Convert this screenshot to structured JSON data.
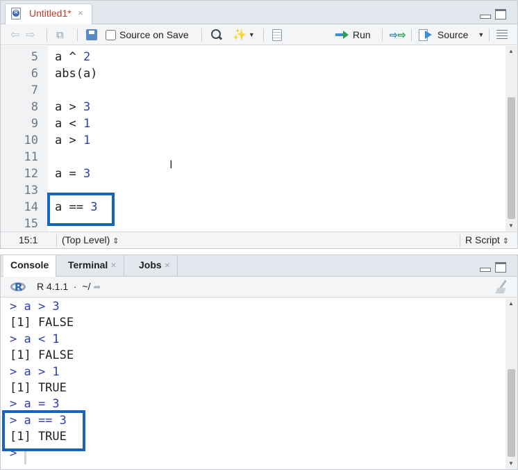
{
  "editor": {
    "tab": {
      "title": "Untitled1*",
      "close": "×",
      "icon": "r-file-icon"
    },
    "toolbar": {
      "source_on_save": "Source on Save",
      "run": "Run",
      "source": "Source",
      "icons": [
        "back-arrow-icon",
        "forward-arrow-icon",
        "show-in-window-icon",
        "save-icon",
        "search-icon",
        "code-tools-wand-icon",
        "compile-notebook-icon",
        "run-icon",
        "rerun-icon",
        "source-icon",
        "outline-icon"
      ]
    },
    "lines": [
      {
        "num": "5",
        "code": "a ^ 2"
      },
      {
        "num": "6",
        "code": "abs(a)"
      },
      {
        "num": "7",
        "code": ""
      },
      {
        "num": "8",
        "code": "a > 3"
      },
      {
        "num": "9",
        "code": "a < 1"
      },
      {
        "num": "10",
        "code": "a > 1"
      },
      {
        "num": "11",
        "code": ""
      },
      {
        "num": "12",
        "code": "a = 3"
      },
      {
        "num": "13",
        "code": ""
      },
      {
        "num": "14",
        "code": "a == 3"
      },
      {
        "num": "15",
        "code": ""
      }
    ],
    "status": {
      "position": "15:1",
      "scope": "(Top Level)",
      "file_type": "R Script",
      "updown": "⇕"
    }
  },
  "console": {
    "tabs": [
      {
        "label": "Console",
        "closable": false
      },
      {
        "label": "Terminal",
        "closable": true
      },
      {
        "label": "Jobs",
        "closable": true
      }
    ],
    "tab_close": "×",
    "r_version": "R 4.1.1",
    "separator": "·",
    "working_dir": "~/",
    "lines": [
      {
        "type": "cmd",
        "text": "> a > 3"
      },
      {
        "type": "out",
        "text": "[1] FALSE"
      },
      {
        "type": "cmd",
        "text": "> a < 1"
      },
      {
        "type": "out",
        "text": "[1] FALSE"
      },
      {
        "type": "cmd",
        "text": "> a > 1"
      },
      {
        "type": "out",
        "text": "[1] TRUE"
      },
      {
        "type": "cmd",
        "text": "> a = 3"
      },
      {
        "type": "cmd",
        "text": "> a == 3"
      },
      {
        "type": "out",
        "text": "[1] TRUE"
      },
      {
        "type": "cmd",
        "text": ">"
      }
    ]
  },
  "colors": {
    "highlight_box": "#1565c0",
    "command": "#2f3eb0",
    "numeric": "#2f3eb0",
    "modified_tab": "#c0392b"
  }
}
